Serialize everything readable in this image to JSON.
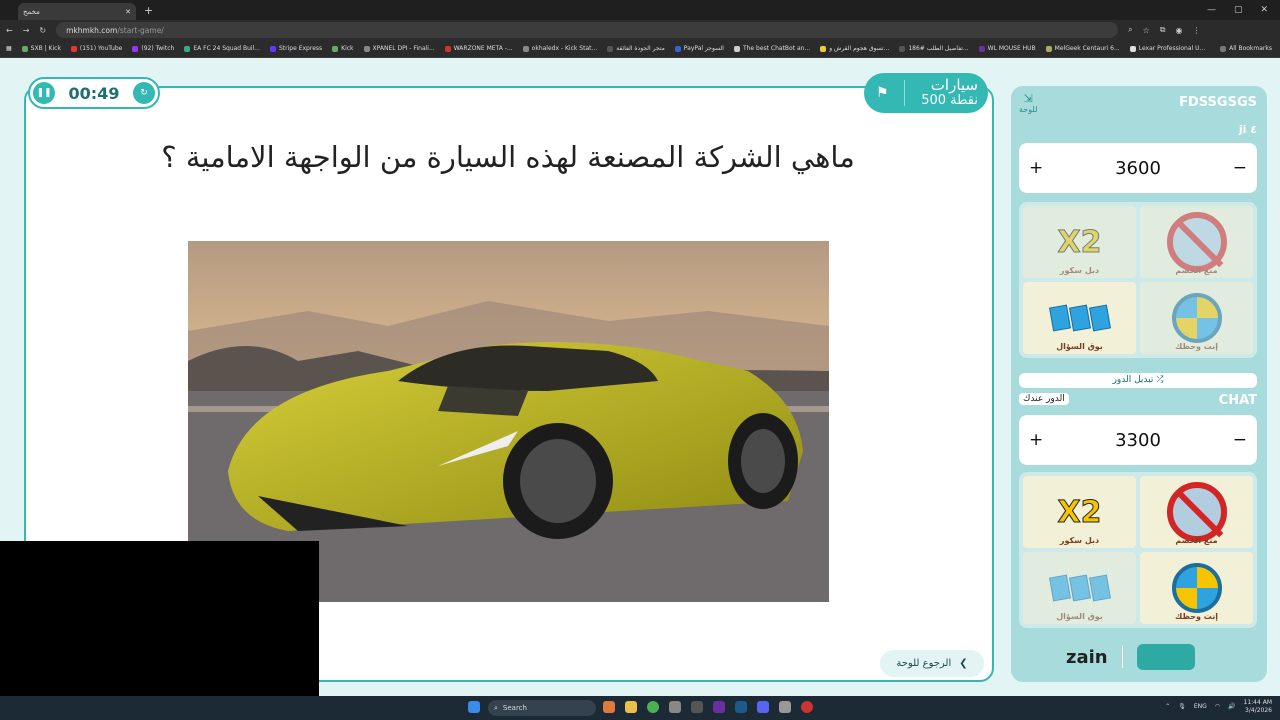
{
  "browser": {
    "tab_title": "مخمخ",
    "url_host": "mkhmkh.com",
    "url_path": "/start-game/",
    "bookmarks": [
      "SXB | Kick",
      "(151) YouTube",
      "(92) Twitch",
      "EA FC 24 Squad Buil...",
      "Stripe Express",
      "Kick",
      "XPANEL DPI - Finali...",
      "WARZONE META -...",
      "okhaledx - Kick Stat...",
      "متجر الجودة الفائقة",
      "PayPal السوجز",
      "The best ChatBot an...",
      "تسوق هجوم القرش و...",
      "تفاصيل الطلب #186...",
      "WL MOUSE HUB",
      "MelGeek Centauri 6...",
      "Lexar Professional U...",
      "All Bookmarks"
    ]
  },
  "game": {
    "timer": "00:49",
    "category_name": "سيارات",
    "category_points": "500 نقطة",
    "question": "ماهي الشركة المصنعة لهذه السيارة من الواجهة الامامية ؟",
    "back_label": "الرجوع للوحة"
  },
  "sidebar": {
    "board_label": "للوحة",
    "team1": {
      "name": "FDSSGSGS",
      "sub": "ji ٤",
      "score": "3600"
    },
    "team2": {
      "name": "CHAT",
      "score": "3300",
      "turn_label": "الدور عندك"
    },
    "swap_label": "تبديل الدور",
    "powerups": {
      "double": "دبل سكور",
      "block": "منع الخصم",
      "steal": "بوق السؤال",
      "luck": "إنت وحظك"
    },
    "sponsor": "zain"
  },
  "taskbar": {
    "search": "Search",
    "lang": "ENG",
    "time": "11:44 AM",
    "date": "3/4/2026"
  },
  "colors": {
    "accent": "#34b8b3",
    "sidebar_bg": "#a8dcdc",
    "page_bg": "#e3f4f4"
  }
}
